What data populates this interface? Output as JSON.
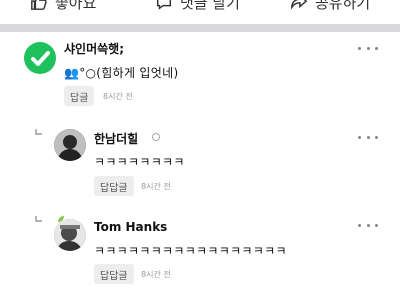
{
  "action_bar": {
    "like_label": "좋아요",
    "comment_label": "댓글 달기",
    "share_label": "공유하기"
  },
  "comments": [
    {
      "author": "샤인머쓱햇;",
      "text": "👥°○(힘하게 입엇네)",
      "reply_label": "답글",
      "time": "8시간 전",
      "avatar_color": "#1fc15d"
    },
    {
      "author": "한남더힐",
      "text": "ㅋㅋㅋㅋㅋㅋㅋㅋ",
      "reply_label": "답답글",
      "time": "8시간 전"
    },
    {
      "author": "Tom Hanks",
      "text": "ㅋㅋㅋㅋㅋㅋㅋㅋㅋㅋㅋㅋㅋㅋㅋㅋㅋ",
      "reply_label": "답답글",
      "time": "8시간 전"
    }
  ]
}
